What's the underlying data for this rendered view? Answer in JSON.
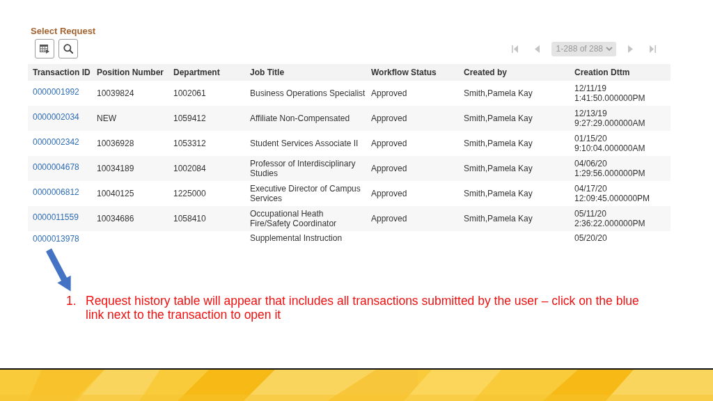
{
  "header": {
    "title": "Select Request"
  },
  "pagination": {
    "range": "1-288 of 288"
  },
  "table": {
    "columns": [
      "Transaction ID",
      "Position Number",
      "Department",
      "Job Title",
      "Workflow Status",
      "Created by",
      "Creation Dttm"
    ],
    "rows": [
      {
        "transaction_id": "0000001992",
        "position_number": "10039824",
        "department": "1002061",
        "job_title": "Business Operations Specialist",
        "workflow_status": "Approved",
        "created_by": "Smith,Pamela Kay",
        "creation_dttm": "12/11/19 1:41:50.000000PM"
      },
      {
        "transaction_id": "0000002034",
        "position_number": "NEW",
        "department": "1059412",
        "job_title": "Affiliate Non-Compensated",
        "workflow_status": "Approved",
        "created_by": "Smith,Pamela Kay",
        "creation_dttm": "12/13/19 9:27:29.000000AM"
      },
      {
        "transaction_id": "0000002342",
        "position_number": "10036928",
        "department": "1053312",
        "job_title": "Student Services Associate II",
        "workflow_status": "Approved",
        "created_by": "Smith,Pamela Kay",
        "creation_dttm": "01/15/20 9:10:04.000000AM"
      },
      {
        "transaction_id": "0000004678",
        "position_number": "10034189",
        "department": "1002084",
        "job_title": "Professor of Interdisciplinary Studies",
        "workflow_status": "Approved",
        "created_by": "Smith,Pamela Kay",
        "creation_dttm": "04/06/20 1:29:56.000000PM"
      },
      {
        "transaction_id": "0000006812",
        "position_number": "10040125",
        "department": "1225000",
        "job_title": "Executive Director of Campus Services",
        "workflow_status": "Approved",
        "created_by": "Smith,Pamela Kay",
        "creation_dttm": "04/17/20 12:09:45.000000PM"
      },
      {
        "transaction_id": "0000011559",
        "position_number": "10034686",
        "department": "1058410",
        "job_title": "Occupational Heath Fire/Safety Coordinator",
        "workflow_status": "Approved",
        "created_by": "Smith,Pamela Kay",
        "creation_dttm": "05/11/20 2:36:22.000000PM"
      },
      {
        "transaction_id": "0000013978",
        "job_title": "Supplemental Instruction",
        "creation_dttm": "05/20/20"
      }
    ]
  },
  "instructions": [
    {
      "number": "1.",
      "text": "Request history table will appear that includes all transactions submitted by the user – click on the blue link next to the transaction to open it"
    }
  ]
}
